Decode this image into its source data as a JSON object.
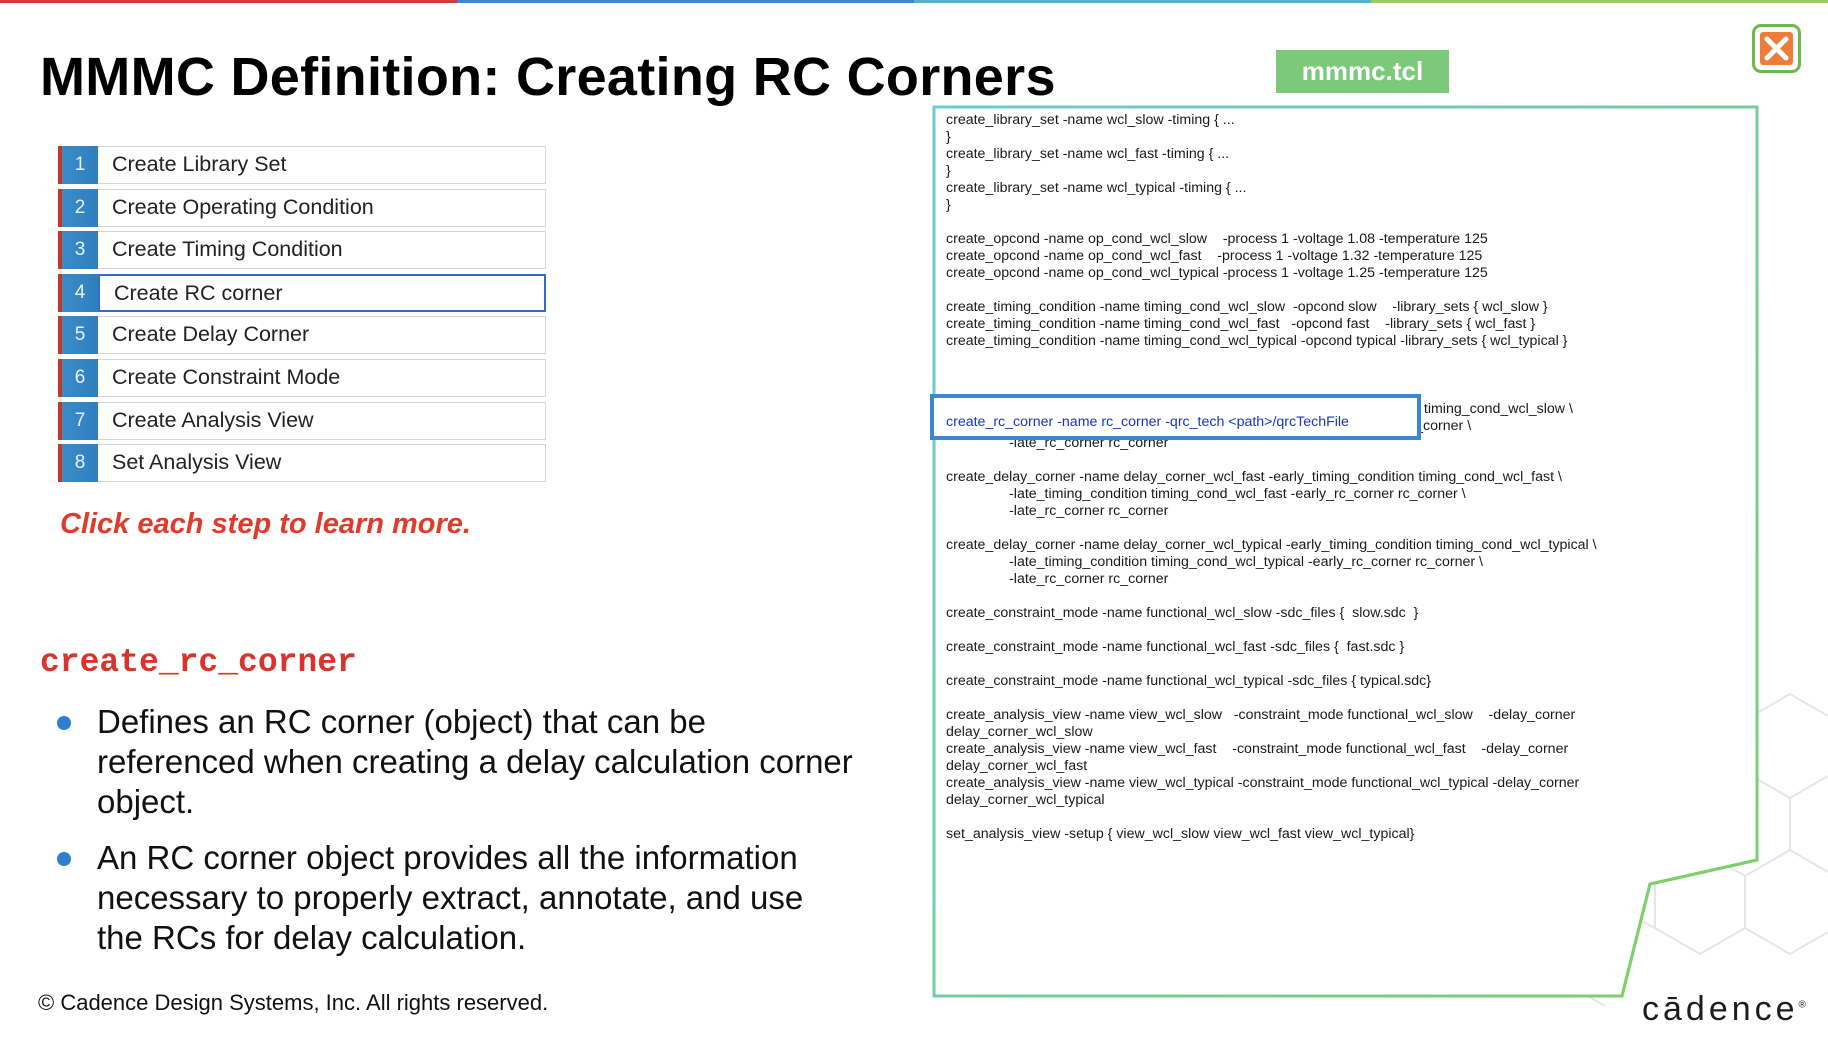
{
  "page": {
    "title": "MMMC Definition: Creating RC Corners",
    "file_tag": "mmmc.tcl",
    "top_bar_colors": [
      "#d13b3b",
      "#3a86d4",
      "#4fb5c9",
      "#9ccc5a"
    ]
  },
  "steps": [
    {
      "num": "1",
      "label": "Create Library Set"
    },
    {
      "num": "2",
      "label": "Create Operating Condition"
    },
    {
      "num": "3",
      "label": "Create Timing Condition"
    },
    {
      "num": "4",
      "label": "Create RC corner",
      "active": true
    },
    {
      "num": "5",
      "label": "Create Delay Corner"
    },
    {
      "num": "6",
      "label": "Create Constraint Mode"
    },
    {
      "num": "7",
      "label": "Create Analysis View"
    },
    {
      "num": "8",
      "label": "Set Analysis View"
    }
  ],
  "hint": "Click each step to learn more.",
  "command": {
    "name": "create_rc_corner",
    "bullets": [
      "Defines an RC corner (object) that can be referenced when creating a delay calculation corner object.",
      "An RC corner object provides all the information necessary to properly extract, annotate, and use the RCs for delay calculation."
    ]
  },
  "code_lines": [
    "create_library_set -name wcl_slow -timing { ...",
    "}",
    "create_library_set -name wcl_fast -timing { ...",
    "}",
    "create_library_set -name wcl_typical -timing { ...",
    "}",
    "",
    "create_opcond -name op_cond_wcl_slow    -process 1 -voltage 1.08 -temperature 125",
    "create_opcond -name op_cond_wcl_fast    -process 1 -voltage 1.32 -temperature 125",
    "create_opcond -name op_cond_wcl_typical -process 1 -voltage 1.25 -temperature 125",
    "",
    "create_timing_condition -name timing_cond_wcl_slow  -opcond slow    -library_sets { wcl_slow }",
    "create_timing_condition -name timing_cond_wcl_fast   -opcond fast    -library_sets { wcl_fast }",
    "create_timing_condition -name timing_cond_wcl_typical -opcond typical -library_sets { wcl_typical }",
    "",
    "",
    "",
    "create_delay_corner -name delay_corner_wcl_slow -early_timing_condition timing_cond_wcl_slow \\",
    "                -late_timing_condition timing_cond_wcl_slow -early_rc_corner rc_corner \\",
    "                -late_rc_corner rc_corner",
    "",
    "create_delay_corner -name delay_corner_wcl_fast -early_timing_condition timing_cond_wcl_fast \\",
    "                -late_timing_condition timing_cond_wcl_fast -early_rc_corner rc_corner \\",
    "                -late_rc_corner rc_corner",
    "",
    "create_delay_corner -name delay_corner_wcl_typical -early_timing_condition timing_cond_wcl_typical \\",
    "                -late_timing_condition timing_cond_wcl_typical -early_rc_corner rc_corner \\",
    "                -late_rc_corner rc_corner",
    "",
    "create_constraint_mode -name functional_wcl_slow -sdc_files {  slow.sdc  }",
    "",
    "create_constraint_mode -name functional_wcl_fast -sdc_files {  fast.sdc }",
    "",
    "create_constraint_mode -name functional_wcl_typical -sdc_files { typical.sdc}",
    "",
    "create_analysis_view -name view_wcl_slow   -constraint_mode functional_wcl_slow    -delay_corner",
    "delay_corner_wcl_slow",
    "create_analysis_view -name view_wcl_fast    -constraint_mode functional_wcl_fast    -delay_corner",
    "delay_corner_wcl_fast",
    "create_analysis_view -name view_wcl_typical -constraint_mode functional_wcl_typical -delay_corner",
    "delay_corner_wcl_typical",
    "",
    "set_analysis_view -setup { view_wcl_slow view_wcl_fast view_wcl_typical}"
  ],
  "highlight_line": "create_rc_corner -name rc_corner -qrc_tech <path>/qrcTechFile",
  "logo": "cādence",
  "copyright": "© Cadence Design Systems, Inc. All rights reserved.",
  "icons": {
    "close": "close-x-icon"
  }
}
